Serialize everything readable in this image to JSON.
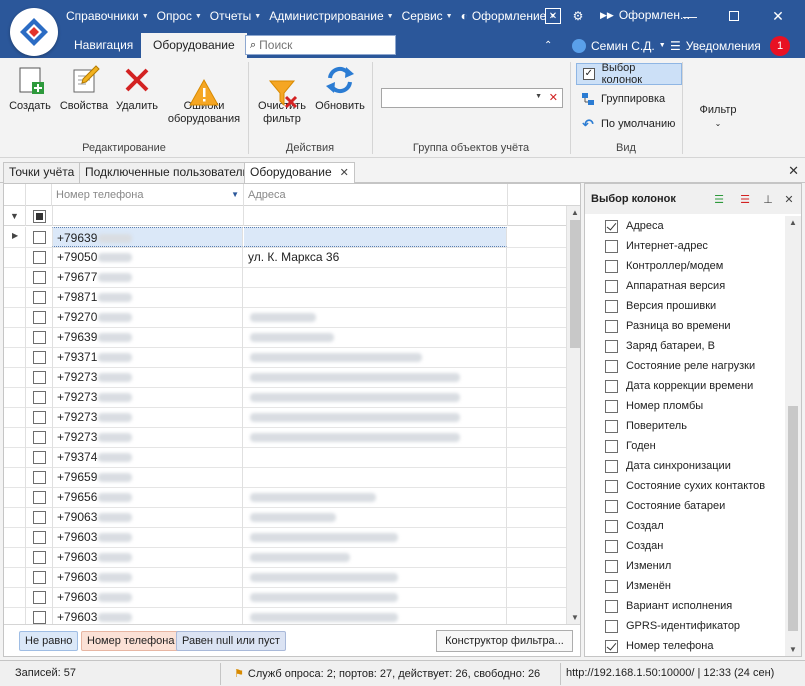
{
  "menu": {
    "items": [
      {
        "label": "Справочники",
        "caret": true
      },
      {
        "label": "Опрос",
        "caret": true
      },
      {
        "label": "Отчеты",
        "caret": true
      },
      {
        "label": "Администрирование",
        "caret": true
      },
      {
        "label": "Сервис",
        "caret": true
      },
      {
        "label": "Оформление",
        "caret": true,
        "icon": "palette-icon"
      }
    ],
    "window_title": "Оформлен..."
  },
  "ribbon_tabs": [
    {
      "label": "Навигация",
      "active": false
    },
    {
      "label": "Оборудование",
      "active": true
    }
  ],
  "search": {
    "placeholder": "Поиск",
    "value": ""
  },
  "user": {
    "name": "Семин С.Д.",
    "notifications_label": "Уведомления",
    "notifications_count": "1"
  },
  "ribbon": {
    "edit_group": {
      "label": "Редактирование",
      "buttons": [
        {
          "label": "Создать",
          "icon": "create-icon"
        },
        {
          "label": "Свойства",
          "icon": "properties-icon"
        },
        {
          "label": "Удалить",
          "icon": "delete-icon"
        },
        {
          "label": "Ошибки\nоборудования",
          "icon": "warning-icon"
        }
      ]
    },
    "actions_group": {
      "label": "Действия",
      "buttons": [
        {
          "label": "Очистить\nфильтр",
          "icon": "clear-filter-icon"
        },
        {
          "label": "Обновить",
          "icon": "refresh-icon"
        }
      ]
    },
    "object_group": {
      "label": "Группа объектов учёта",
      "value": ""
    },
    "view_group": {
      "label": "Вид",
      "buttons": [
        {
          "label": "Выбор колонок",
          "active": true,
          "icon": "column-chooser-icon"
        },
        {
          "label": "Группировка",
          "active": false,
          "icon": "grouping-icon"
        },
        {
          "label": "По умолчанию",
          "active": false,
          "icon": "undo-icon"
        }
      ]
    },
    "filter_group": {
      "label": "Фильтр"
    }
  },
  "doc_tabs": [
    {
      "label": "Точки учёта",
      "active": false
    },
    {
      "label": "Подключенные пользователи",
      "active": false
    },
    {
      "label": "Оборудование",
      "active": true
    }
  ],
  "grid": {
    "columns": [
      "Номер телефона",
      "Адреса"
    ],
    "rows": [
      {
        "phone": "+79639",
        "addr": "",
        "selected": true,
        "pw": 34,
        "aw": 0
      },
      {
        "phone": "+79050",
        "addr": "ул. К. Маркса 36",
        "selected": false,
        "pw": 34,
        "aw": 0
      },
      {
        "phone": "+79677",
        "addr": "",
        "selected": false,
        "pw": 34,
        "aw": 0
      },
      {
        "phone": "+79871",
        "addr": "",
        "selected": false,
        "pw": 34,
        "aw": 0
      },
      {
        "phone": "+79270",
        "addr": "",
        "selected": false,
        "pw": 34,
        "aw": 66
      },
      {
        "phone": "+79639",
        "addr": "",
        "selected": false,
        "pw": 34,
        "aw": 84
      },
      {
        "phone": "+79371",
        "addr": "",
        "selected": false,
        "pw": 34,
        "aw": 172
      },
      {
        "phone": "+79273",
        "addr": "",
        "selected": false,
        "pw": 34,
        "aw": 210
      },
      {
        "phone": "+79273",
        "addr": "",
        "selected": false,
        "pw": 34,
        "aw": 210
      },
      {
        "phone": "+79273",
        "addr": "",
        "selected": false,
        "pw": 34,
        "aw": 210
      },
      {
        "phone": "+79273",
        "addr": "",
        "selected": false,
        "pw": 34,
        "aw": 210
      },
      {
        "phone": "+79374",
        "addr": "",
        "selected": false,
        "pw": 34,
        "aw": 0
      },
      {
        "phone": "+79659",
        "addr": "",
        "selected": false,
        "pw": 34,
        "aw": 0
      },
      {
        "phone": "+79656",
        "addr": "",
        "selected": false,
        "pw": 34,
        "aw": 126
      },
      {
        "phone": "+79063",
        "addr": "",
        "selected": false,
        "pw": 34,
        "aw": 86
      },
      {
        "phone": "+79603",
        "addr": "",
        "selected": false,
        "pw": 34,
        "aw": 148
      },
      {
        "phone": "+79603",
        "addr": "",
        "selected": false,
        "pw": 34,
        "aw": 100
      },
      {
        "phone": "+79603",
        "addr": "",
        "selected": false,
        "pw": 34,
        "aw": 148
      },
      {
        "phone": "+79603",
        "addr": "",
        "selected": false,
        "pw": 34,
        "aw": 148
      },
      {
        "phone": "+79603",
        "addr": "",
        "selected": false,
        "pw": 34,
        "aw": 148
      }
    ]
  },
  "filter_chips": [
    {
      "label": "Не равно",
      "bg": "#dbe8f8",
      "border": "#9fbde4"
    },
    {
      "label": "Номер телефона",
      "bg": "#fbe1d6",
      "border": "#e7b6a3"
    },
    {
      "label": "Равен null или пуст",
      "bg": "#dbe3f3",
      "border": "#a9b9d9"
    }
  ],
  "filter_builder_label": "Конструктор фильтра...",
  "column_chooser": {
    "title": "Выбор колонок",
    "items": [
      {
        "label": "Адреса",
        "checked": true
      },
      {
        "label": "Интернет-адрес",
        "checked": false
      },
      {
        "label": "Контроллер/модем",
        "checked": false
      },
      {
        "label": "Аппаратная версия",
        "checked": false
      },
      {
        "label": "Версия прошивки",
        "checked": false
      },
      {
        "label": "Разница во времени",
        "checked": false
      },
      {
        "label": "Заряд батареи, В",
        "checked": false
      },
      {
        "label": "Состояние реле нагрузки",
        "checked": false
      },
      {
        "label": "Дата коррекции времени",
        "checked": false
      },
      {
        "label": "Номер пломбы",
        "checked": false
      },
      {
        "label": "Поверитель",
        "checked": false
      },
      {
        "label": "Годен",
        "checked": false
      },
      {
        "label": "Дата синхронизации",
        "checked": false
      },
      {
        "label": "Состояние сухих контактов",
        "checked": false
      },
      {
        "label": "Состояние батареи",
        "checked": false
      },
      {
        "label": "Создал",
        "checked": false
      },
      {
        "label": "Создан",
        "checked": false
      },
      {
        "label": "Изменил",
        "checked": false
      },
      {
        "label": "Изменён",
        "checked": false
      },
      {
        "label": "Вариант исполнения",
        "checked": false
      },
      {
        "label": "GPRS-идентификатор",
        "checked": false
      },
      {
        "label": "Номер телефона",
        "checked": true
      }
    ]
  },
  "status": {
    "records": "Записей: 57",
    "services": "Служб опроса: 2; портов: 27, действует: 26, свободно: 26",
    "server": "http://192.168.1.50:10000/ | 12:33 (24 сен)"
  },
  "colors": {
    "titlebar": "#2b579a",
    "accent_red": "#e81123"
  }
}
